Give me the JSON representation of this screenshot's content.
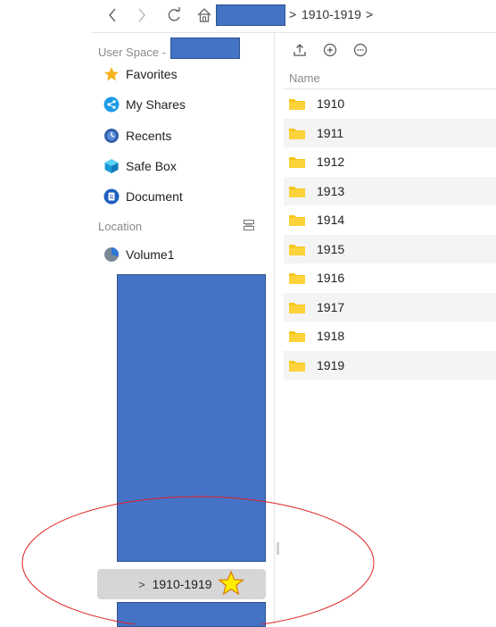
{
  "toolbar": {
    "back_icon": "chevron-left-icon",
    "forward_icon": "chevron-right-icon",
    "refresh_icon": "refresh-icon",
    "home_icon": "home-icon",
    "breadcrumb_current": "1910-1919",
    "sep": ">"
  },
  "sidebar": {
    "user_space_label": "User Space -",
    "items": [
      {
        "label": "Favorites",
        "icon": "star-icon"
      },
      {
        "label": "My Shares",
        "icon": "share-icon"
      },
      {
        "label": "Recents",
        "icon": "clock-icon"
      },
      {
        "label": "Safe Box",
        "icon": "cube-icon"
      },
      {
        "label": "Document",
        "icon": "document-icon"
      }
    ],
    "location_label": "Location",
    "volume_label": "Volume1",
    "selected_folder": "1910-1919",
    "selected_chevron": ">"
  },
  "main": {
    "toolbar_icons": [
      "upload-icon",
      "add-icon",
      "more-icon"
    ],
    "name_header": "Name",
    "folders": [
      "1910",
      "1911",
      "1912",
      "1913",
      "1914",
      "1915",
      "1916",
      "1917",
      "1918",
      "1919"
    ]
  },
  "colors": {
    "redaction": "#4472c4",
    "folder": "#f5c518",
    "selected_bg": "#d6d6d6",
    "annotation": "#e02020",
    "star": "#ffee00"
  }
}
